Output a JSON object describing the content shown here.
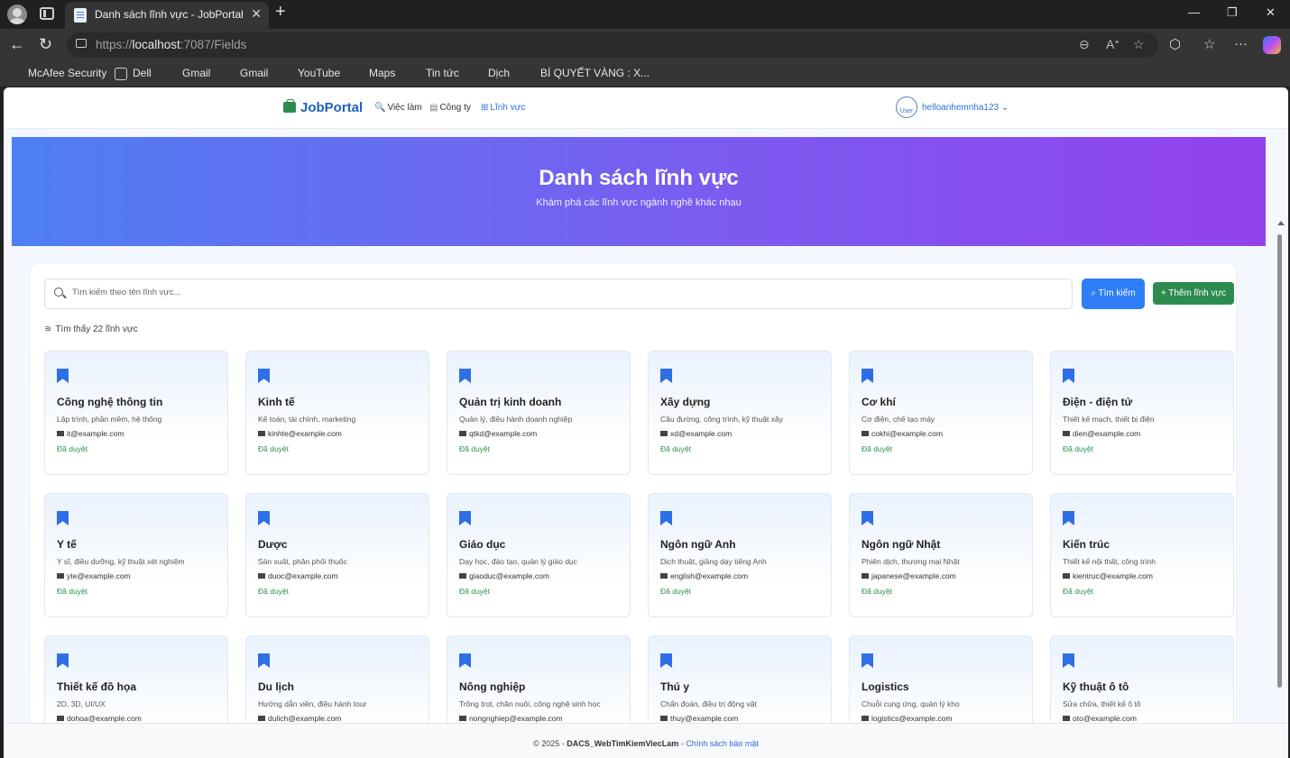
{
  "browser": {
    "tab_title": "Danh sách lĩnh vực - JobPortal",
    "tab_close": "✕",
    "new_tab": "+",
    "url_prefix": "https://",
    "url_host": "localhost",
    "url_rest": ":7087/Fields",
    "window_controls": [
      "—",
      "❐",
      "✕"
    ],
    "bookmarks": [
      {
        "label": "McAfee Security",
        "color": "#c0392b"
      },
      {
        "label": "Dell",
        "color": "#353535"
      },
      {
        "label": "Gmail",
        "color": "#ea4335"
      },
      {
        "label": "Gmail",
        "color": "#e53935"
      },
      {
        "label": "YouTube",
        "color": "#ff0000"
      },
      {
        "label": "Maps",
        "color": "#4285f4"
      },
      {
        "label": "Tin tức",
        "color": "#3d6bd6"
      },
      {
        "label": "Dịch",
        "color": "#5b8ed8"
      },
      {
        "label": "BÍ QUYẾT VÀNG : X...",
        "color": "#d93025"
      }
    ]
  },
  "nav": {
    "brand": "JobPortal",
    "links": [
      {
        "label": "Việc làm",
        "icon": "🔍"
      },
      {
        "label": "Công ty",
        "icon": "▤"
      },
      {
        "label": "Lĩnh vực",
        "icon": "⊞"
      }
    ],
    "username": "helloanhemnha123",
    "avatar_text": "User"
  },
  "hero": {
    "title": "Danh sách lĩnh vực",
    "subtitle": "Khám phá các lĩnh vực ngành nghề khác nhau"
  },
  "search": {
    "placeholder": "Tìm kiếm theo tên lĩnh vực...",
    "button": "Tìm kiếm",
    "add_button": "+ Thêm lĩnh vực"
  },
  "found_text": "Tìm thấy 22 lĩnh vực",
  "fields": [
    {
      "name": "Công nghệ thông tin",
      "desc": "Lập trình, phần mềm, hệ thống",
      "email": "it@example.com",
      "status": "Đã duyệt"
    },
    {
      "name": "Kinh tế",
      "desc": "Kế toán, tài chính, marketing",
      "email": "kinhte@example.com",
      "status": "Đã duyệt"
    },
    {
      "name": "Quản trị kinh doanh",
      "desc": "Quản lý, điều hành doanh nghiệp",
      "email": "qtkd@example.com",
      "status": "Đã duyệt"
    },
    {
      "name": "Xây dựng",
      "desc": "Cầu đường, công trình, kỹ thuật xây",
      "email": "xd@example.com",
      "status": "Đã duyệt"
    },
    {
      "name": "Cơ khí",
      "desc": "Cơ điện, chế tạo máy",
      "email": "cokhi@example.com",
      "status": "Đã duyệt"
    },
    {
      "name": "Điện - điện tử",
      "desc": "Thiết kế mạch, thiết bị điện",
      "email": "dien@example.com",
      "status": "Đã duyệt"
    },
    {
      "name": "Y tế",
      "desc": "Y sĩ, điều dưỡng, kỹ thuật xét nghiệm",
      "email": "yte@example.com",
      "status": "Đã duyệt"
    },
    {
      "name": "Dược",
      "desc": "Sản xuất, phân phối thuốc",
      "email": "duoc@example.com",
      "status": "Đã duyệt"
    },
    {
      "name": "Giáo dục",
      "desc": "Dạy học, đào tạo, quản lý giáo dục",
      "email": "giaoduc@example.com",
      "status": "Đã duyệt"
    },
    {
      "name": "Ngôn ngữ Anh",
      "desc": "Dịch thuật, giảng dạy tiếng Anh",
      "email": "english@example.com",
      "status": "Đã duyệt"
    },
    {
      "name": "Ngôn ngữ Nhật",
      "desc": "Phiên dịch, thương mại Nhật",
      "email": "japanese@example.com",
      "status": "Đã duyệt"
    },
    {
      "name": "Kiến trúc",
      "desc": "Thiết kế nội thất, công trình",
      "email": "kientruc@example.com",
      "status": "Đã duyệt"
    },
    {
      "name": "Thiết kế đồ họa",
      "desc": "2D, 3D, UI/UX",
      "email": "dohoa@example.com",
      "status": ""
    },
    {
      "name": "Du lịch",
      "desc": "Hướng dẫn viên, điều hành tour",
      "email": "dulich@example.com",
      "status": ""
    },
    {
      "name": "Nông nghiệp",
      "desc": "Trồng trọt, chăn nuôi, công nghệ sinh học",
      "email": "nongnghiep@example.com",
      "status": ""
    },
    {
      "name": "Thú y",
      "desc": "Chẩn đoán, điều trị động vật",
      "email": "thuy@example.com",
      "status": ""
    },
    {
      "name": "Logistics",
      "desc": "Chuỗi cung ứng, quản lý kho",
      "email": "logistics@example.com",
      "status": ""
    },
    {
      "name": "Kỹ thuật ô tô",
      "desc": "Sửa chữa, thiết kế ô tô",
      "email": "oto@example.com",
      "status": ""
    }
  ],
  "footer": {
    "copyright": "© 2025 - ",
    "project": "DACS_WebTimKiemViecLam",
    "separator": " - ",
    "privacy": "Chính sách bảo mật"
  },
  "colors": {
    "accent": "#2f7ef6",
    "success": "#2e8b4f",
    "hero_start": "#4f7ff3",
    "hero_end": "#9342ec"
  }
}
